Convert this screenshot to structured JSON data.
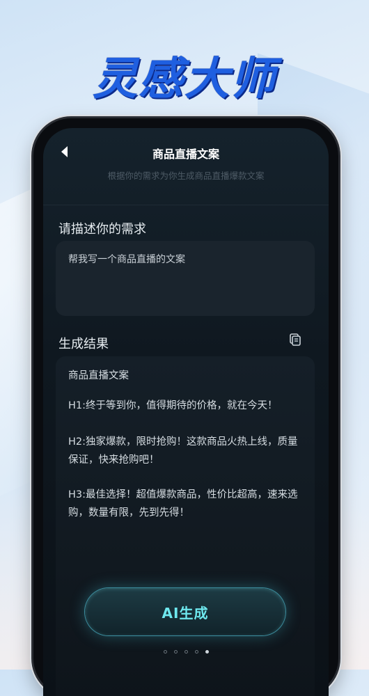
{
  "banner": {
    "title": "灵感大师"
  },
  "header": {
    "title": "商品直播文案",
    "subtitle": "根据你的需求为你生成商品直播爆款文案"
  },
  "input": {
    "label": "请描述你的需求",
    "value": "帮我写一个商品直播的文案"
  },
  "result": {
    "label": "生成结果",
    "title": "商品直播文案",
    "paragraphs": [
      "H1:终于等到你，值得期待的价格，就在今天！",
      "H2:独家爆款，限时抢购！这款商品火热上线，质量保证，快来抢购吧！",
      "H3:最佳选择！超值爆款商品，性价比超高，速来选购，数量有限，先到先得！"
    ]
  },
  "actions": {
    "generate_label": "AI生成"
  },
  "pager": {
    "count": 5,
    "active_index": 4
  },
  "colors": {
    "accent": "#6ee8ee",
    "brand_blue": "#1f5fe0"
  }
}
